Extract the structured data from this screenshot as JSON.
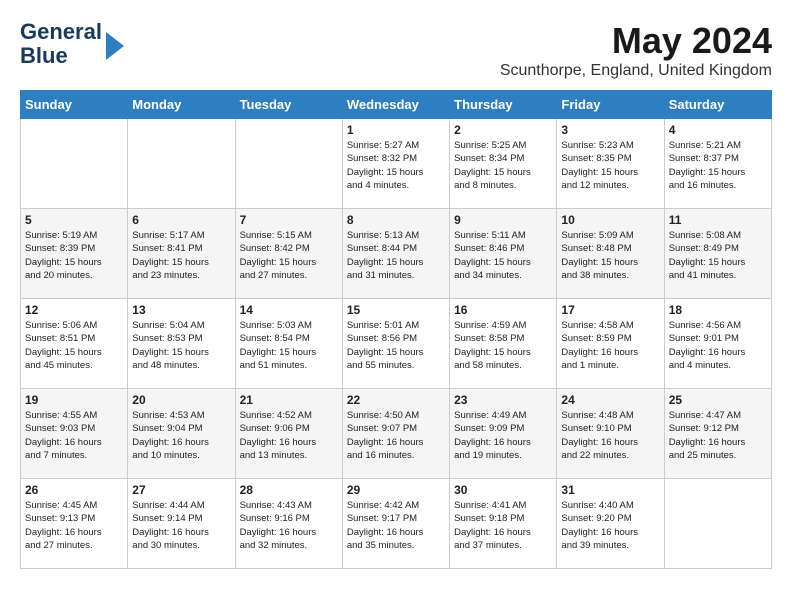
{
  "header": {
    "logo_line1": "General",
    "logo_line2": "Blue",
    "month_year": "May 2024",
    "location": "Scunthorpe, England, United Kingdom"
  },
  "days_of_week": [
    "Sunday",
    "Monday",
    "Tuesday",
    "Wednesday",
    "Thursday",
    "Friday",
    "Saturday"
  ],
  "weeks": [
    [
      {
        "day": "",
        "content": ""
      },
      {
        "day": "",
        "content": ""
      },
      {
        "day": "",
        "content": ""
      },
      {
        "day": "1",
        "content": "Sunrise: 5:27 AM\nSunset: 8:32 PM\nDaylight: 15 hours\nand 4 minutes."
      },
      {
        "day": "2",
        "content": "Sunrise: 5:25 AM\nSunset: 8:34 PM\nDaylight: 15 hours\nand 8 minutes."
      },
      {
        "day": "3",
        "content": "Sunrise: 5:23 AM\nSunset: 8:35 PM\nDaylight: 15 hours\nand 12 minutes."
      },
      {
        "day": "4",
        "content": "Sunrise: 5:21 AM\nSunset: 8:37 PM\nDaylight: 15 hours\nand 16 minutes."
      }
    ],
    [
      {
        "day": "5",
        "content": "Sunrise: 5:19 AM\nSunset: 8:39 PM\nDaylight: 15 hours\nand 20 minutes."
      },
      {
        "day": "6",
        "content": "Sunrise: 5:17 AM\nSunset: 8:41 PM\nDaylight: 15 hours\nand 23 minutes."
      },
      {
        "day": "7",
        "content": "Sunrise: 5:15 AM\nSunset: 8:42 PM\nDaylight: 15 hours\nand 27 minutes."
      },
      {
        "day": "8",
        "content": "Sunrise: 5:13 AM\nSunset: 8:44 PM\nDaylight: 15 hours\nand 31 minutes."
      },
      {
        "day": "9",
        "content": "Sunrise: 5:11 AM\nSunset: 8:46 PM\nDaylight: 15 hours\nand 34 minutes."
      },
      {
        "day": "10",
        "content": "Sunrise: 5:09 AM\nSunset: 8:48 PM\nDaylight: 15 hours\nand 38 minutes."
      },
      {
        "day": "11",
        "content": "Sunrise: 5:08 AM\nSunset: 8:49 PM\nDaylight: 15 hours\nand 41 minutes."
      }
    ],
    [
      {
        "day": "12",
        "content": "Sunrise: 5:06 AM\nSunset: 8:51 PM\nDaylight: 15 hours\nand 45 minutes."
      },
      {
        "day": "13",
        "content": "Sunrise: 5:04 AM\nSunset: 8:53 PM\nDaylight: 15 hours\nand 48 minutes."
      },
      {
        "day": "14",
        "content": "Sunrise: 5:03 AM\nSunset: 8:54 PM\nDaylight: 15 hours\nand 51 minutes."
      },
      {
        "day": "15",
        "content": "Sunrise: 5:01 AM\nSunset: 8:56 PM\nDaylight: 15 hours\nand 55 minutes."
      },
      {
        "day": "16",
        "content": "Sunrise: 4:59 AM\nSunset: 8:58 PM\nDaylight: 15 hours\nand 58 minutes."
      },
      {
        "day": "17",
        "content": "Sunrise: 4:58 AM\nSunset: 8:59 PM\nDaylight: 16 hours\nand 1 minute."
      },
      {
        "day": "18",
        "content": "Sunrise: 4:56 AM\nSunset: 9:01 PM\nDaylight: 16 hours\nand 4 minutes."
      }
    ],
    [
      {
        "day": "19",
        "content": "Sunrise: 4:55 AM\nSunset: 9:03 PM\nDaylight: 16 hours\nand 7 minutes."
      },
      {
        "day": "20",
        "content": "Sunrise: 4:53 AM\nSunset: 9:04 PM\nDaylight: 16 hours\nand 10 minutes."
      },
      {
        "day": "21",
        "content": "Sunrise: 4:52 AM\nSunset: 9:06 PM\nDaylight: 16 hours\nand 13 minutes."
      },
      {
        "day": "22",
        "content": "Sunrise: 4:50 AM\nSunset: 9:07 PM\nDaylight: 16 hours\nand 16 minutes."
      },
      {
        "day": "23",
        "content": "Sunrise: 4:49 AM\nSunset: 9:09 PM\nDaylight: 16 hours\nand 19 minutes."
      },
      {
        "day": "24",
        "content": "Sunrise: 4:48 AM\nSunset: 9:10 PM\nDaylight: 16 hours\nand 22 minutes."
      },
      {
        "day": "25",
        "content": "Sunrise: 4:47 AM\nSunset: 9:12 PM\nDaylight: 16 hours\nand 25 minutes."
      }
    ],
    [
      {
        "day": "26",
        "content": "Sunrise: 4:45 AM\nSunset: 9:13 PM\nDaylight: 16 hours\nand 27 minutes."
      },
      {
        "day": "27",
        "content": "Sunrise: 4:44 AM\nSunset: 9:14 PM\nDaylight: 16 hours\nand 30 minutes."
      },
      {
        "day": "28",
        "content": "Sunrise: 4:43 AM\nSunset: 9:16 PM\nDaylight: 16 hours\nand 32 minutes."
      },
      {
        "day": "29",
        "content": "Sunrise: 4:42 AM\nSunset: 9:17 PM\nDaylight: 16 hours\nand 35 minutes."
      },
      {
        "day": "30",
        "content": "Sunrise: 4:41 AM\nSunset: 9:18 PM\nDaylight: 16 hours\nand 37 minutes."
      },
      {
        "day": "31",
        "content": "Sunrise: 4:40 AM\nSunset: 9:20 PM\nDaylight: 16 hours\nand 39 minutes."
      },
      {
        "day": "",
        "content": ""
      }
    ]
  ]
}
